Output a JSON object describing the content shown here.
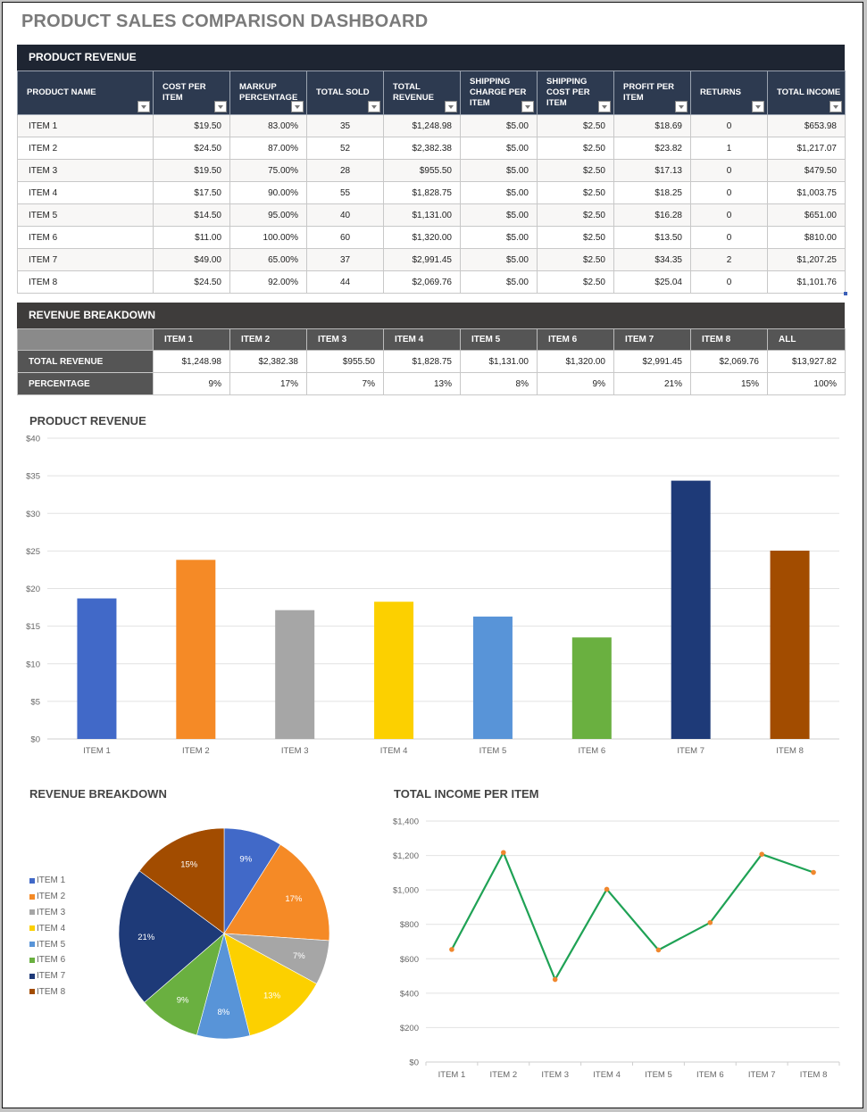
{
  "title": "PRODUCT SALES COMPARISON DASHBOARD",
  "product_revenue": {
    "heading": "PRODUCT REVENUE",
    "columns": [
      "PRODUCT NAME",
      "COST PER ITEM",
      "MARKUP PERCENTAGE",
      "TOTAL SOLD",
      "TOTAL REVENUE",
      "SHIPPING CHARGE PER ITEM",
      "SHIPPING COST PER ITEM",
      "PROFIT PER ITEM",
      "RETURNS",
      "TOTAL INCOME"
    ],
    "rows": [
      [
        "ITEM 1",
        "$19.50",
        "83.00%",
        "35",
        "$1,248.98",
        "$5.00",
        "$2.50",
        "$18.69",
        "0",
        "$653.98"
      ],
      [
        "ITEM 2",
        "$24.50",
        "87.00%",
        "52",
        "$2,382.38",
        "$5.00",
        "$2.50",
        "$23.82",
        "1",
        "$1,217.07"
      ],
      [
        "ITEM 3",
        "$19.50",
        "75.00%",
        "28",
        "$955.50",
        "$5.00",
        "$2.50",
        "$17.13",
        "0",
        "$479.50"
      ],
      [
        "ITEM 4",
        "$17.50",
        "90.00%",
        "55",
        "$1,828.75",
        "$5.00",
        "$2.50",
        "$18.25",
        "0",
        "$1,003.75"
      ],
      [
        "ITEM 5",
        "$14.50",
        "95.00%",
        "40",
        "$1,131.00",
        "$5.00",
        "$2.50",
        "$16.28",
        "0",
        "$651.00"
      ],
      [
        "ITEM 6",
        "$11.00",
        "100.00%",
        "60",
        "$1,320.00",
        "$5.00",
        "$2.50",
        "$13.50",
        "0",
        "$810.00"
      ],
      [
        "ITEM 7",
        "$49.00",
        "65.00%",
        "37",
        "$2,991.45",
        "$5.00",
        "$2.50",
        "$34.35",
        "2",
        "$1,207.25"
      ],
      [
        "ITEM 8",
        "$24.50",
        "92.00%",
        "44",
        "$2,069.76",
        "$5.00",
        "$2.50",
        "$25.04",
        "0",
        "$1,101.76"
      ]
    ]
  },
  "revenue_breakdown": {
    "heading": "REVENUE BREAKDOWN",
    "columns": [
      "",
      "ITEM 1",
      "ITEM 2",
      "ITEM 3",
      "ITEM 4",
      "ITEM 5",
      "ITEM 6",
      "ITEM 7",
      "ITEM 8",
      "ALL"
    ],
    "rows": [
      [
        "TOTAL REVENUE",
        "$1,248.98",
        "$2,382.38",
        "$955.50",
        "$1,828.75",
        "$1,131.00",
        "$1,320.00",
        "$2,991.45",
        "$2,069.76",
        "$13,927.82"
      ],
      [
        "PERCENTAGE",
        "9%",
        "17%",
        "7%",
        "13%",
        "8%",
        "9%",
        "21%",
        "15%",
        "100%"
      ]
    ]
  },
  "colors": {
    "header_navy": "#1e2532",
    "header_blue": "#2d3a50",
    "breakdown_dark": "#3e3c3b",
    "items": [
      "#4169c8",
      "#f58a26",
      "#a6a6a6",
      "#fcd000",
      "#5894d8",
      "#6ab040",
      "#1e3a78",
      "#a24c00"
    ],
    "line": "#1fa255",
    "marker": "#f0872e"
  },
  "chart_data": [
    {
      "type": "bar",
      "title": "PRODUCT REVENUE",
      "categories": [
        "ITEM 1",
        "ITEM 2",
        "ITEM 3",
        "ITEM 4",
        "ITEM 5",
        "ITEM 6",
        "ITEM 7",
        "ITEM 8"
      ],
      "values": [
        18.69,
        23.82,
        17.13,
        18.25,
        16.28,
        13.5,
        34.35,
        25.04
      ],
      "xlabel": "",
      "ylabel": "",
      "ylim": [
        0,
        40
      ],
      "yticks": [
        0,
        5,
        10,
        15,
        20,
        25,
        30,
        35,
        40
      ],
      "ytick_labels": [
        "$0",
        "$5",
        "$10",
        "$15",
        "$20",
        "$25",
        "$30",
        "$35",
        "$40"
      ],
      "grid": true,
      "legend": "none"
    },
    {
      "type": "pie",
      "title": "REVENUE BREAKDOWN",
      "labels": [
        "ITEM 1",
        "ITEM 2",
        "ITEM 3",
        "ITEM 4",
        "ITEM 5",
        "ITEM 6",
        "ITEM 7",
        "ITEM 8"
      ],
      "values": [
        1248.98,
        2382.38,
        955.5,
        1828.75,
        1131.0,
        1320.0,
        2991.45,
        2069.76
      ],
      "data_labels": [
        "9%",
        "17%",
        "7%",
        "13%",
        "8%",
        "9%",
        "21%",
        "15%"
      ],
      "legend": "left"
    },
    {
      "type": "line",
      "title": "TOTAL INCOME PER ITEM",
      "categories": [
        "ITEM 1",
        "ITEM 2",
        "ITEM 3",
        "ITEM 4",
        "ITEM 5",
        "ITEM 6",
        "ITEM 7",
        "ITEM 8"
      ],
      "values": [
        653.98,
        1217.07,
        479.5,
        1003.75,
        651.0,
        810.0,
        1207.25,
        1101.76
      ],
      "ylim": [
        0,
        1400
      ],
      "yticks": [
        0,
        200,
        400,
        600,
        800,
        1000,
        1200,
        1400
      ],
      "ytick_labels": [
        "$0",
        "$200",
        "$400",
        "$600",
        "$800",
        "$1,000",
        "$1,200",
        "$1,400"
      ],
      "grid": true,
      "legend": "none"
    }
  ]
}
